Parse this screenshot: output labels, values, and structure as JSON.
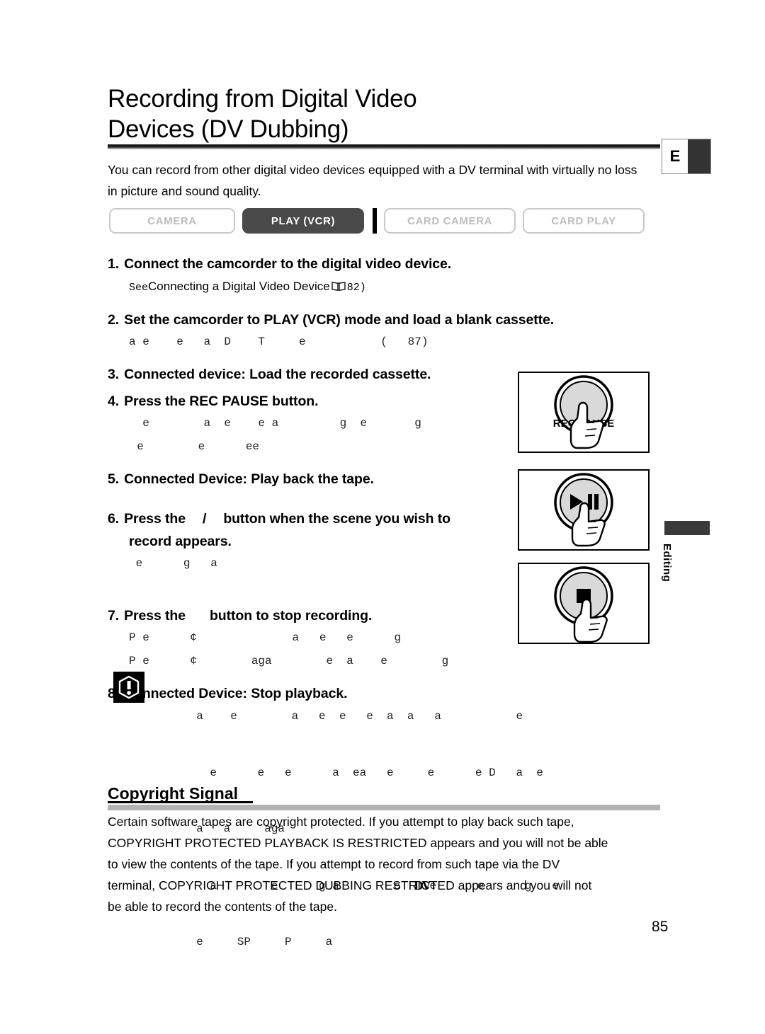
{
  "page": {
    "number": "85",
    "language_tab": "E",
    "side_tab": "Editing"
  },
  "title": {
    "line1": "Recording from Digital Video",
    "line2": "Devices (DV Dubbing)"
  },
  "intro": "You can record from other digital video devices equipped with a DV terminal with virtually no loss in picture and sound quality.",
  "modes": [
    {
      "label": "CAMERA",
      "active": false
    },
    {
      "label": "PLAY (VCR)",
      "active": true
    },
    {
      "label": "CARD CAMERA",
      "active": false
    },
    {
      "label": "CARD PLAY",
      "active": false
    }
  ],
  "steps": [
    {
      "num": "1.",
      "heading": "Connect the camcorder to the digital video device.",
      "sub_prefix": "See",
      "sub_main": "Connecting a Digital Video Device",
      "sub_page": "82)"
    },
    {
      "num": "2.",
      "heading": "Set the camcorder to PLAY (VCR) mode and load a blank cassette.",
      "sub_degraded": "a e    e   a  D    T     e           (   87)"
    },
    {
      "num": "3.",
      "heading": "Connected device: Load the recorded cassette."
    },
    {
      "num": "4.",
      "heading": "Press the REC PAUSE button.",
      "sub_degraded_1": "  e        a  e    e a         g  e       g",
      "sub_degraded_2": "  e        e      ee"
    },
    {
      "num": "5.",
      "heading": "Connected Device: Play back the tape."
    },
    {
      "num": "6.",
      "heading_part1": "Press the",
      "heading_symbol": "/",
      "heading_part2": "button when the scene you wish to",
      "heading_line2": "record appears.",
      "sub_degraded": " e      g   a"
    },
    {
      "num": "7.",
      "heading_part1": "Press the",
      "heading_part2": "button to stop recording.",
      "sub_degraded_1": "P e      ¢              a   e   e      g",
      "sub_degraded_2": "P e      ¢        aga        e  a    e        g"
    },
    {
      "num": "8.",
      "heading": "Connected Device: Stop playback."
    }
  ],
  "illustrations": [
    {
      "name": "rec-pause-button",
      "label": "REC PAUSE",
      "icon": "circle-plain"
    },
    {
      "name": "play-pause-button",
      "label": "",
      "icon": "play-pause"
    },
    {
      "name": "stop-button",
      "label": "",
      "icon": "stop-square"
    }
  ],
  "note": {
    "icon": "exclamation-warning-icon",
    "lines": [
      "  a    e        a   e  e   e  a  a   a           e",
      "    e      e   e      a  ea   e     e      e D   a  e",
      "  a   a     aga",
      "    a        e      g a        e  ■e      e      g   e",
      "  e     SP     P     a"
    ],
    "dv_logo": "DV"
  },
  "copyright": {
    "heading": "Copyright Signal",
    "body_lines": [
      "Certain software tapes are copyright protected. If you attempt to play back such tape,",
      " COPYRIGHT PROTECTED PLAYBACK IS RESTRICTED  appears and you will not be able",
      "to view the contents of the tape. If you attempt to record from such tape via the DV",
      "terminal,  COPYRIGHT PROTECTED DUBBING RESTRICTED  appears and you will not",
      "be able to record the contents of the tape."
    ]
  },
  "colors": {
    "active_mode_bg": "#4a4a4a",
    "inactive_mode_border": "#c9c9c9",
    "inactive_mode_text": "#bdbdbd",
    "rule_dark": "#1a1a1a",
    "copyright_rule": "#b3b3b3",
    "tab_dark": "#333333"
  }
}
